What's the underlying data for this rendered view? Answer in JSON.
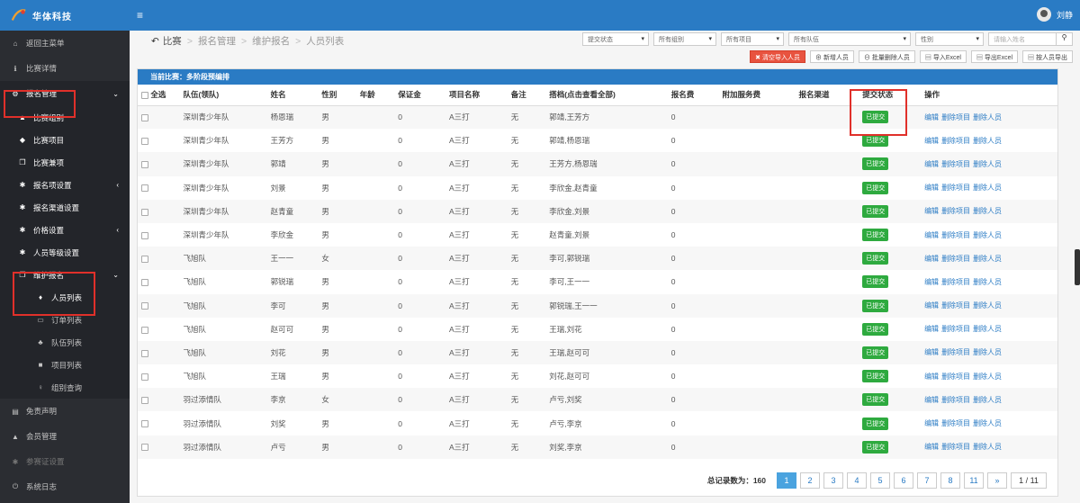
{
  "brand": {
    "name": "华体科技"
  },
  "topbar": {
    "username": "刘静"
  },
  "sidebar": {
    "items": [
      {
        "label": "返回主菜单",
        "icon": "home-icon"
      },
      {
        "label": "比赛详情",
        "icon": "info-icon"
      },
      {
        "label": "报名管理",
        "icon": "gears-icon"
      },
      {
        "label": "比赛组别",
        "icon": "user-icon"
      },
      {
        "label": "比赛项目",
        "icon": "game-icon"
      },
      {
        "label": "比赛兼项",
        "icon": "copy-icon"
      },
      {
        "label": "报名项设置",
        "icon": "gear-icon"
      },
      {
        "label": "报名渠道设置",
        "icon": "gear-icon"
      },
      {
        "label": "价格设置",
        "icon": "gear-icon"
      },
      {
        "label": "人员等级设置",
        "icon": "gear-icon"
      },
      {
        "label": "维护报名",
        "icon": "copy-icon"
      },
      {
        "label": "人员列表",
        "icon": "person-icon"
      },
      {
        "label": "订单列表",
        "icon": "card-icon"
      },
      {
        "label": "队伍列表",
        "icon": "users-icon"
      },
      {
        "label": "项目列表",
        "icon": "square-icon"
      },
      {
        "label": "组别查询",
        "icon": "female-icon"
      },
      {
        "label": "免责声明",
        "icon": "list-icon"
      },
      {
        "label": "会员管理",
        "icon": "lock-icon"
      },
      {
        "label": "参赛证设置",
        "icon": "gear-icon"
      },
      {
        "label": "系统日志",
        "icon": "power-icon"
      }
    ]
  },
  "breadcrumb": {
    "back": "比赛",
    "items": [
      "报名管理",
      "维护报名",
      "人员列表"
    ]
  },
  "filters": {
    "status": "提交状态",
    "group": "所有组别",
    "project": "所有项目",
    "team": "所有队伍",
    "gender": "性别",
    "search_placeholder": "请输入姓名"
  },
  "actions": {
    "clear_import": "✖ 清空导入人员",
    "add": "新增人员",
    "batch_delete": "批量删除人员",
    "import_excel": "导入Excel",
    "export_excel": "导出Excel",
    "export_by_person": "按人员导出"
  },
  "panel": {
    "title": "当前比赛：多阶段预编排"
  },
  "table": {
    "headers": [
      "全选",
      "队伍(领队)",
      "姓名",
      "性别",
      "年龄",
      "保证金",
      "项目名称",
      "备注",
      "搭档(点击查看全部)",
      "报名费",
      "附加服务费",
      "报名渠道",
      "提交状态",
      "操作"
    ],
    "op_labels": [
      "编辑",
      "删除项目",
      "删除人员"
    ],
    "rows": [
      {
        "team": "深圳青少年队",
        "name": "杨恩瑞",
        "gender": "男",
        "deposit": "0",
        "project": "A三打",
        "note": "无",
        "partner": "郭靖,王芳方",
        "fee": "0",
        "status": "已提交"
      },
      {
        "team": "深圳青少年队",
        "name": "王芳方",
        "gender": "男",
        "deposit": "0",
        "project": "A三打",
        "note": "无",
        "partner": "郭靖,杨恩瑞",
        "fee": "0",
        "status": "已提交"
      },
      {
        "team": "深圳青少年队",
        "name": "郭靖",
        "gender": "男",
        "deposit": "0",
        "project": "A三打",
        "note": "无",
        "partner": "王芳方,杨恩瑞",
        "fee": "0",
        "status": "已提交"
      },
      {
        "team": "深圳青少年队",
        "name": "刘景",
        "gender": "男",
        "deposit": "0",
        "project": "A三打",
        "note": "无",
        "partner": "李欣金,赵青童",
        "fee": "0",
        "status": "已提交"
      },
      {
        "team": "深圳青少年队",
        "name": "赵青童",
        "gender": "男",
        "deposit": "0",
        "project": "A三打",
        "note": "无",
        "partner": "李欣金,刘景",
        "fee": "0",
        "status": "已提交"
      },
      {
        "team": "深圳青少年队",
        "name": "李欣金",
        "gender": "男",
        "deposit": "0",
        "project": "A三打",
        "note": "无",
        "partner": "赵青童,刘景",
        "fee": "0",
        "status": "已提交"
      },
      {
        "team": "飞旭队",
        "name": "王一一",
        "gender": "女",
        "deposit": "0",
        "project": "A三打",
        "note": "无",
        "partner": "李可,郭锐瑞",
        "fee": "0",
        "status": "已提交"
      },
      {
        "team": "飞旭队",
        "name": "郭锐瑞",
        "gender": "男",
        "deposit": "0",
        "project": "A三打",
        "note": "无",
        "partner": "李可,王一一",
        "fee": "0",
        "status": "已提交"
      },
      {
        "team": "飞旭队",
        "name": "李可",
        "gender": "男",
        "deposit": "0",
        "project": "A三打",
        "note": "无",
        "partner": "郭锐瑞,王一一",
        "fee": "0",
        "status": "已提交"
      },
      {
        "team": "飞旭队",
        "name": "赵可可",
        "gender": "男",
        "deposit": "0",
        "project": "A三打",
        "note": "无",
        "partner": "王瑞,刘花",
        "fee": "0",
        "status": "已提交"
      },
      {
        "team": "飞旭队",
        "name": "刘花",
        "gender": "男",
        "deposit": "0",
        "project": "A三打",
        "note": "无",
        "partner": "王瑞,赵可可",
        "fee": "0",
        "status": "已提交"
      },
      {
        "team": "飞旭队",
        "name": "王瑞",
        "gender": "男",
        "deposit": "0",
        "project": "A三打",
        "note": "无",
        "partner": "刘花,赵可可",
        "fee": "0",
        "status": "已提交"
      },
      {
        "team": "羽过添情队",
        "name": "李京",
        "gender": "女",
        "deposit": "0",
        "project": "A三打",
        "note": "无",
        "partner": "卢亏,刘奖",
        "fee": "0",
        "status": "已提交"
      },
      {
        "team": "羽过添情队",
        "name": "刘奖",
        "gender": "男",
        "deposit": "0",
        "project": "A三打",
        "note": "无",
        "partner": "卢亏,李京",
        "fee": "0",
        "status": "已提交"
      },
      {
        "team": "羽过添情队",
        "name": "卢亏",
        "gender": "男",
        "deposit": "0",
        "project": "A三打",
        "note": "无",
        "partner": "刘奖,李京",
        "fee": "0",
        "status": "已提交"
      }
    ]
  },
  "pagination": {
    "total_label": "总记录数为：160",
    "pages": [
      "1",
      "2",
      "3",
      "4",
      "5",
      "6",
      "7",
      "8",
      "11",
      "»"
    ],
    "current": "1",
    "indicator": "1 / 11"
  },
  "colors": {
    "topbar": "#2a7bc4",
    "sidebar": "#2b2d32",
    "status_badge": "#2eaa3f",
    "highlight": "#e0302a"
  }
}
